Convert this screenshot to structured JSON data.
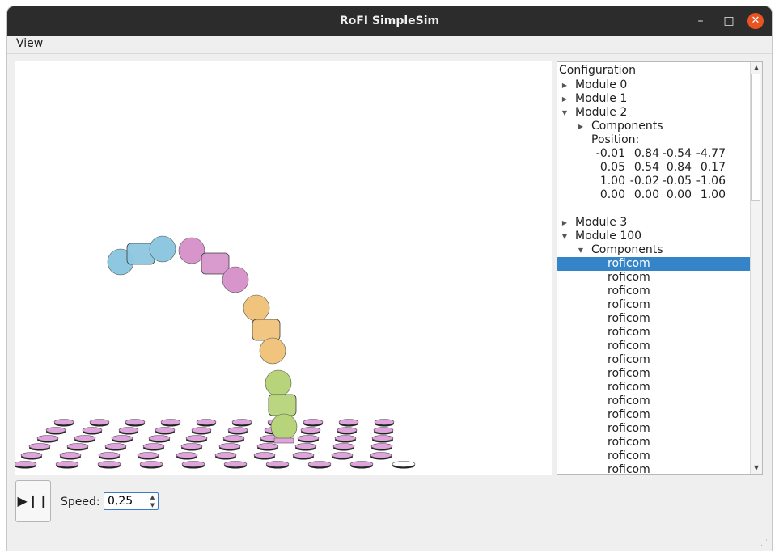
{
  "window": {
    "title": "RoFI SimpleSim",
    "controls": {
      "minimize": "–",
      "maximize": "□",
      "close": "✕"
    }
  },
  "menu": {
    "items": [
      "View"
    ]
  },
  "tree": {
    "header": "Configuration",
    "modules": {
      "m0": "Module 0",
      "m1": "Module 1",
      "m2": "Module 2",
      "m2_components": "Components",
      "m2_position": "Position:",
      "m3": "Module 3",
      "m100": "Module 100",
      "m100_components": "Components"
    },
    "position_matrix": [
      [
        "-0.01",
        "0.84",
        "-0.54",
        "-4.77"
      ],
      [
        "0.05",
        "0.54",
        "0.84",
        "0.17"
      ],
      [
        "1.00",
        "-0.02",
        "-0.05",
        "-1.06"
      ],
      [
        "0.00",
        "0.00",
        "0.00",
        "1.00"
      ]
    ],
    "component_items": [
      "roficom",
      "roficom",
      "roficom",
      "roficom",
      "roficom",
      "roficom",
      "roficom",
      "roficom",
      "roficom",
      "roficom",
      "roficom",
      "roficom",
      "roficom",
      "roficom",
      "roficom",
      "roficom"
    ],
    "selected_index": 0
  },
  "controls": {
    "play_pause_label": "▶❙❙",
    "speed_label": "Speed:",
    "speed_value": "0,25"
  },
  "colors": {
    "selection": "#3584c8",
    "module_blue": "#8ec7e0",
    "module_pink": "#d895cc",
    "module_orange": "#f0c47c",
    "module_green": "#b8d47a",
    "pad_pink": "#e0a4dc"
  }
}
